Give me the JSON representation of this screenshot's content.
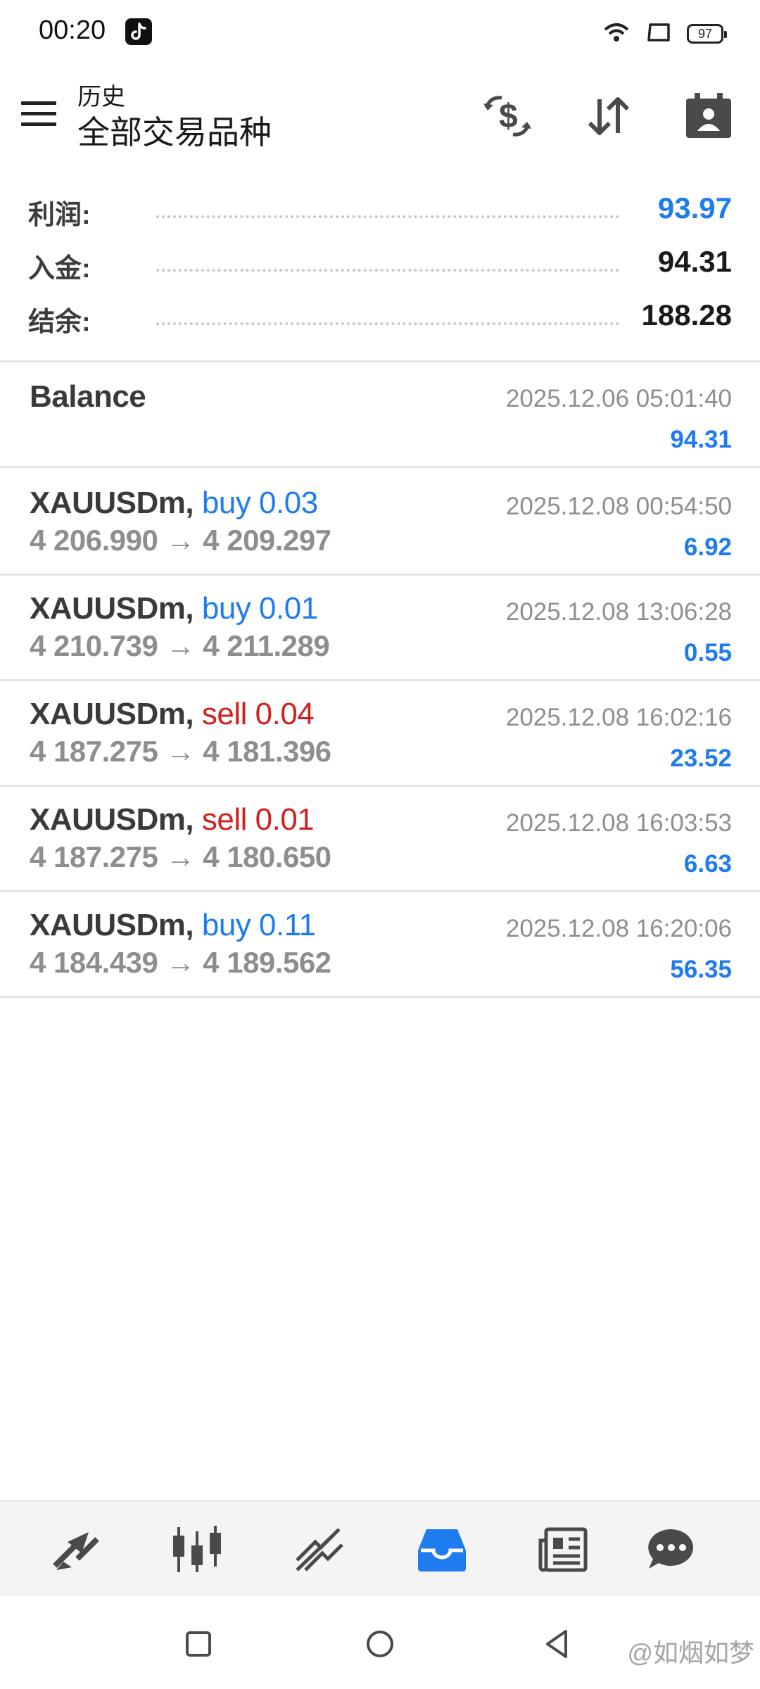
{
  "status_bar": {
    "time": "00:20",
    "battery": "97",
    "icons": [
      "tiktok-icon",
      "wifi-icon",
      "screen-icon",
      "battery-icon"
    ]
  },
  "header": {
    "subtitle": "历史",
    "title": "全部交易品种",
    "icons": [
      "menu-icon",
      "currency-exchange-icon",
      "sort-icon",
      "calendar-person-icon"
    ]
  },
  "summary": {
    "profit_label": "利润:",
    "profit_value": "93.97",
    "deposit_label": "入金:",
    "deposit_value": "94.31",
    "balance_label": "结余:",
    "balance_value": "188.28"
  },
  "balance_entry": {
    "label": "Balance",
    "time": "2025.12.06 05:01:40",
    "amount": "94.31"
  },
  "deals": [
    {
      "symbol": "XAUUSDm,",
      "side": "buy 0.03",
      "type": "buy",
      "prices": "4 206.990 → 4 209.297",
      "time": "2025.12.08 00:54:50",
      "profit": "6.92"
    },
    {
      "symbol": "XAUUSDm,",
      "side": "buy 0.01",
      "type": "buy",
      "prices": "4 210.739 → 4 211.289",
      "time": "2025.12.08 13:06:28",
      "profit": "0.55"
    },
    {
      "symbol": "XAUUSDm,",
      "side": "sell 0.04",
      "type": "sell",
      "prices": "4 187.275 → 4 181.396",
      "time": "2025.12.08 16:02:16",
      "profit": "23.52"
    },
    {
      "symbol": "XAUUSDm,",
      "side": "sell 0.01",
      "type": "sell",
      "prices": "4 187.275 → 4 180.650",
      "time": "2025.12.08 16:03:53",
      "profit": "6.63"
    },
    {
      "symbol": "XAUUSDm,",
      "side": "buy 0.11",
      "type": "buy",
      "prices": "4 184.439 → 4 189.562",
      "time": "2025.12.08 16:20:06",
      "profit": "56.35"
    }
  ],
  "tabs": [
    {
      "icon": "quotes-icon",
      "active": false
    },
    {
      "icon": "chart-icon",
      "active": false
    },
    {
      "icon": "trade-icon",
      "active": false
    },
    {
      "icon": "history-icon",
      "active": true
    },
    {
      "icon": "news-icon",
      "active": false
    },
    {
      "icon": "messages-icon",
      "active": false
    }
  ],
  "system_nav": {
    "icons": [
      "recent-apps-icon",
      "home-icon",
      "back-icon"
    ],
    "watermark": "@如烟如梦"
  },
  "colors": {
    "accent_blue": "#1e7cf0",
    "sell_red": "#d21f1f",
    "muted_gray": "#8e8e8e",
    "icon_dark": "#4a4a4a"
  }
}
